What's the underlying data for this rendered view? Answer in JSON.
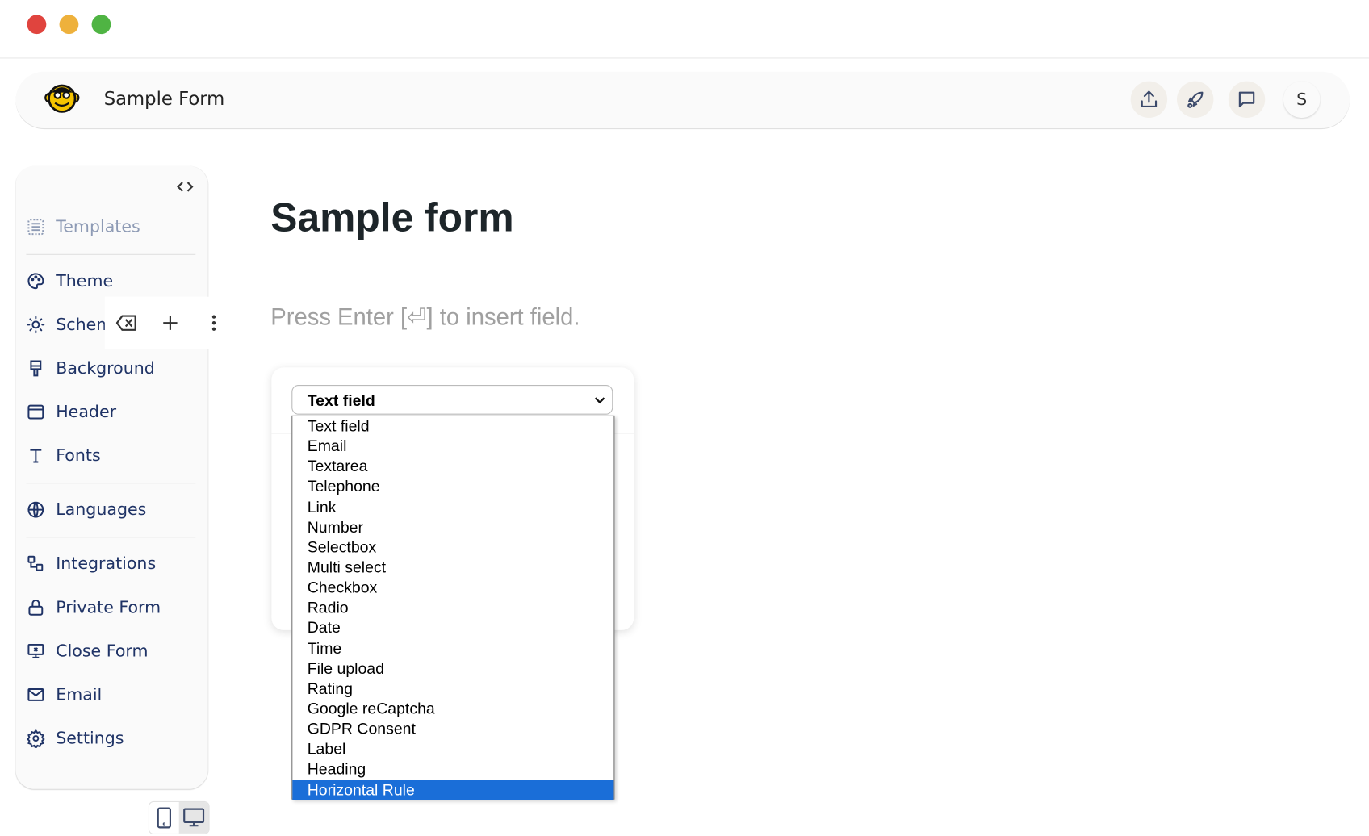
{
  "window": {
    "controls": [
      "close",
      "minimize",
      "maximize"
    ],
    "colors": {
      "close": "#e0443e",
      "minimize": "#eeb13c",
      "maximize": "#4fb443"
    }
  },
  "header": {
    "title": "Sample Form",
    "logo": "monkey-logo",
    "actions": [
      {
        "name": "share-icon"
      },
      {
        "name": "rocket-icon"
      },
      {
        "name": "comment-icon"
      }
    ],
    "avatar_initial": "S"
  },
  "sidebar": {
    "collapse_icon": "code-brackets-icon",
    "items": [
      {
        "label": "Templates",
        "icon": "templates-icon",
        "disabled": true
      },
      {
        "label": "Theme",
        "icon": "palette-icon"
      },
      {
        "label": "Schem",
        "icon": "sun-moon-icon"
      },
      {
        "label": "Background",
        "icon": "brush-icon"
      },
      {
        "label": "Header",
        "icon": "layout-header-icon"
      },
      {
        "label": "Fonts",
        "icon": "type-icon"
      },
      {
        "label": "Languages",
        "icon": "globe-icon"
      },
      {
        "label": "Integrations",
        "icon": "integrations-icon"
      },
      {
        "label": "Private Form",
        "icon": "lock-icon"
      },
      {
        "label": "Close Form",
        "icon": "close-form-icon"
      },
      {
        "label": "Email",
        "icon": "mail-icon"
      },
      {
        "label": "Settings",
        "icon": "gear-icon"
      }
    ],
    "device_toggle": {
      "options": [
        "mobile",
        "desktop"
      ],
      "selected": "desktop"
    }
  },
  "field_toolbar": {
    "icons": [
      "backspace-icon",
      "plus-icon",
      "more-vertical-icon"
    ]
  },
  "main": {
    "title": "Sample form",
    "placeholder": "Press Enter [⏎] to insert field.",
    "field_type_select": {
      "value": "Text field",
      "options": [
        "Text field",
        "Email",
        "Textarea",
        "Telephone",
        "Link",
        "Number",
        "Selectbox",
        "Multi select",
        "Checkbox",
        "Radio",
        "Date",
        "Time",
        "File upload",
        "Rating",
        "Google reCaptcha",
        "GDPR Consent",
        "Label",
        "Heading",
        "Horizontal Rule"
      ],
      "highlighted": "Horizontal Rule",
      "highlight_color": "#1a6ed8"
    }
  }
}
